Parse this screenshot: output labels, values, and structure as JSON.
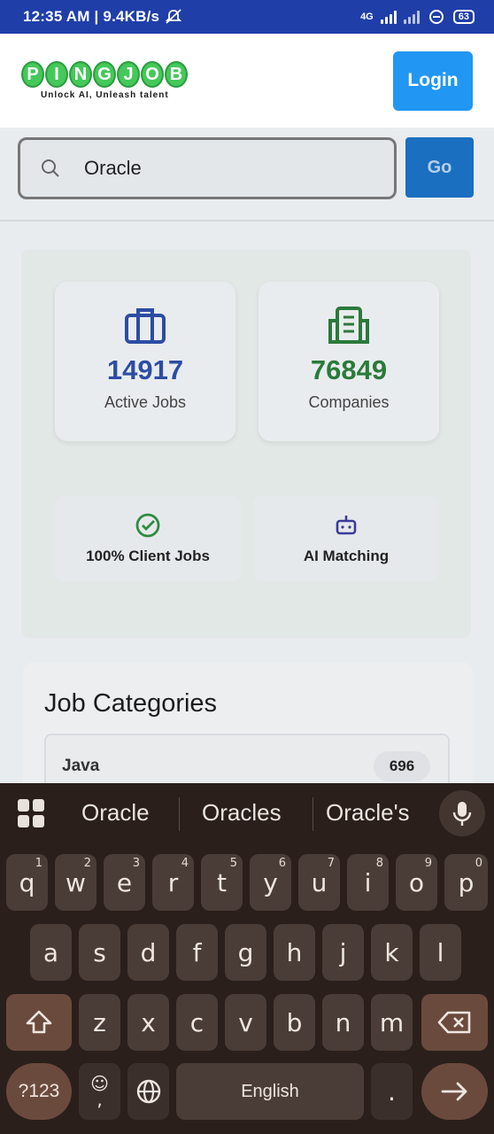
{
  "status_bar": {
    "time_speed": "12:35 AM | 9.4KB/s",
    "network": "4G",
    "battery": "63"
  },
  "header": {
    "logo_letters": [
      "P",
      "I",
      "N",
      "G",
      "J",
      "O",
      "B"
    ],
    "tagline": "Unlock AI, Unleash talent",
    "login_label": "Login"
  },
  "search": {
    "value": "Oracle",
    "go_label": "Go"
  },
  "stats": [
    {
      "value": "14917",
      "label": "Active Jobs",
      "color": "#2c4da3",
      "icon": "briefcase-icon"
    },
    {
      "value": "76849",
      "label": "Companies",
      "color": "#2a7a3a",
      "icon": "building-icon"
    }
  ],
  "features": [
    {
      "label": "100% Client Jobs",
      "icon": "check-circle-icon",
      "color": "#2e8b3e"
    },
    {
      "label": "AI Matching",
      "icon": "robot-icon",
      "color": "#3a3a9a"
    }
  ],
  "categories": {
    "title": "Job Categories",
    "items": [
      {
        "name": "Java",
        "count": "696"
      }
    ]
  },
  "keyboard": {
    "suggestions": [
      "Oracle",
      "Oracles",
      "Oracle's"
    ],
    "row1": [
      [
        "q",
        "1"
      ],
      [
        "w",
        "2"
      ],
      [
        "e",
        "3"
      ],
      [
        "r",
        "4"
      ],
      [
        "t",
        "5"
      ],
      [
        "y",
        "6"
      ],
      [
        "u",
        "7"
      ],
      [
        "i",
        "8"
      ],
      [
        "o",
        "9"
      ],
      [
        "p",
        "0"
      ]
    ],
    "row2": [
      "a",
      "s",
      "d",
      "f",
      "g",
      "h",
      "j",
      "k",
      "l"
    ],
    "row3": [
      "z",
      "x",
      "c",
      "v",
      "b",
      "n",
      "m"
    ],
    "symbols_label": "?123",
    "emoji_sub": ",",
    "space_label": "English",
    "period_label": "."
  }
}
